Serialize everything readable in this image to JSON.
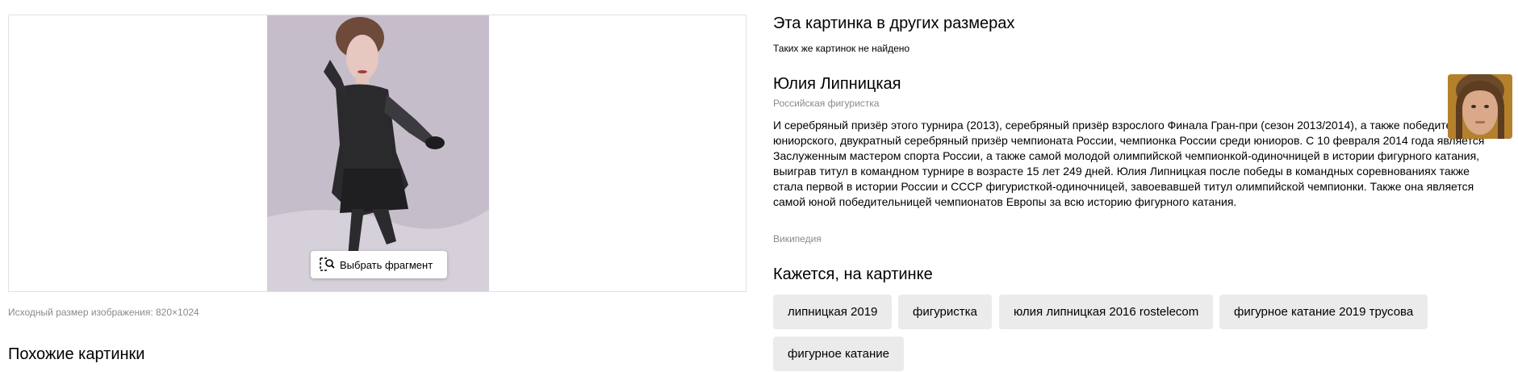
{
  "preview": {
    "select_fragment_label": "Выбрать фрагмент",
    "original_size_text": "Исходный размер изображения: 820×1024"
  },
  "similar": {
    "heading": "Похожие картинки"
  },
  "other_sizes": {
    "heading": "Эта картинка в других размерах",
    "empty_text": "Таких же картинок не найдено"
  },
  "entity": {
    "name": "Юлия Липницкая",
    "subtitle": "Российская фигуристка",
    "bio": "И серебряный призёр этого турнира (2013), серебряный призёр взрослого Финала Гран-при (сезон 2013/2014), а также победительница юниорского, двукратный серебряный призёр чемпионата России, чемпионка России среди юниоров. С 10 февраля 2014 года является Заслуженным мастером спорта России, а также самой молодой олимпийской чемпионкой-одиночницей в истории фигурного катания, выиграв титул в командном турнире в возрасте 15 лет 249 дней. Юлия Липницкая после победы в командных соревнованиях также стала первой в истории России и СССР фигуристкой-одиночницей, завоевавшей титул олимпийской чемпионки. Также она является самой юной победительницей чемпионатов Европы за всю историю фигурного катания.",
    "source": "Википедия"
  },
  "seems": {
    "heading": "Кажется, на картинке",
    "tags": [
      "липницкая 2019",
      "фигуристка",
      "юлия липницкая 2016 rostelecom",
      "фигурное катание 2019 трусова",
      "фигурное катание"
    ]
  },
  "icons": {
    "select_fragment": "crop-search-icon"
  }
}
